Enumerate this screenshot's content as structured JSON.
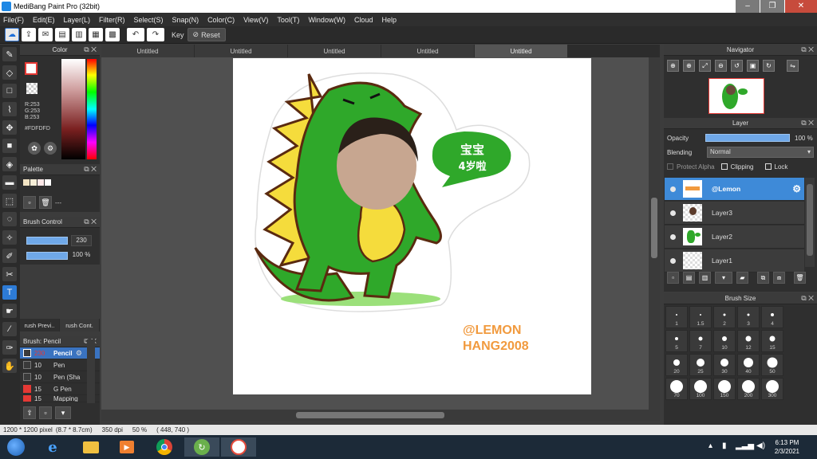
{
  "window": {
    "title": "MediBang Paint Pro (32bit)",
    "minimize": "–",
    "restore": "❐",
    "close": "✕"
  },
  "menu": [
    "File(F)",
    "Edit(E)",
    "Layer(L)",
    "Filter(R)",
    "Select(S)",
    "Snap(N)",
    "Color(C)",
    "View(V)",
    "Tool(T)",
    "Window(W)",
    "Cloud",
    "Help"
  ],
  "toolbar": {
    "key_label": "Key",
    "reset_label": "Reset"
  },
  "tabs": [
    "Untitled",
    "Untitled",
    "Untitled",
    "Untitled",
    "Untitled"
  ],
  "color_panel": {
    "title": "Color",
    "r": "R:253",
    "g": "G:253",
    "b": "B:253",
    "hex": "#FDFDFD"
  },
  "palette_panel": {
    "title": "Palette",
    "dash": "---",
    "swatches": [
      "#f3e4c4",
      "#f6eed8",
      "#fde8e8",
      "#ffffff"
    ]
  },
  "brush_control": {
    "title": "Brush Control",
    "size": "230",
    "opacity": "100 %"
  },
  "brush_tabs": [
    "rush Previ..",
    "rush Cont."
  ],
  "brush_list": {
    "title": "Brush: Pencil",
    "items": [
      {
        "size": "230",
        "name": "Pencil",
        "color": "#3a73c0"
      },
      {
        "size": "10",
        "name": "Pen",
        "color": "#3a3a3a"
      },
      {
        "size": "10",
        "name": "Pen (Sha",
        "color": "#3a3a3a"
      },
      {
        "size": "15",
        "name": "G Pen",
        "color": "#e53935"
      },
      {
        "size": "15",
        "name": "Mapping",
        "color": "#e53935"
      }
    ]
  },
  "canvas": {
    "speech_text_line1": "宝宝",
    "speech_text_line2": "4岁啦",
    "watermark_line1": "@LEMON",
    "watermark_line2": "HANG2008"
  },
  "navigator": {
    "title": "Navigator"
  },
  "layer_panel": {
    "title": "Layer",
    "opacity_label": "Opacity",
    "opacity_value": "100 %",
    "blending_label": "Blending",
    "blending_value": "Normal",
    "protect_alpha": "Protect Alpha",
    "clipping": "Clipping",
    "lock": "Lock",
    "layers": [
      "@Lemon",
      "Layer3",
      "Layer2",
      "Layer1"
    ]
  },
  "brush_size": {
    "title": "Brush Size",
    "sizes": [
      "1",
      "1.5",
      "2",
      "3",
      "4",
      "5",
      "7",
      "10",
      "12",
      "15",
      "20",
      "25",
      "30",
      "40",
      "50",
      "70",
      "100",
      "150",
      "200",
      "300"
    ]
  },
  "status": {
    "pixels": "1200 * 1200 pixel",
    "size_cm": "(8.7 * 8.7cm)",
    "dpi": "350 dpi",
    "zoom": "50 %",
    "coords": "( 448, 740 )"
  },
  "clock": {
    "time": "6:13 PM",
    "date": "2/3/2021"
  }
}
